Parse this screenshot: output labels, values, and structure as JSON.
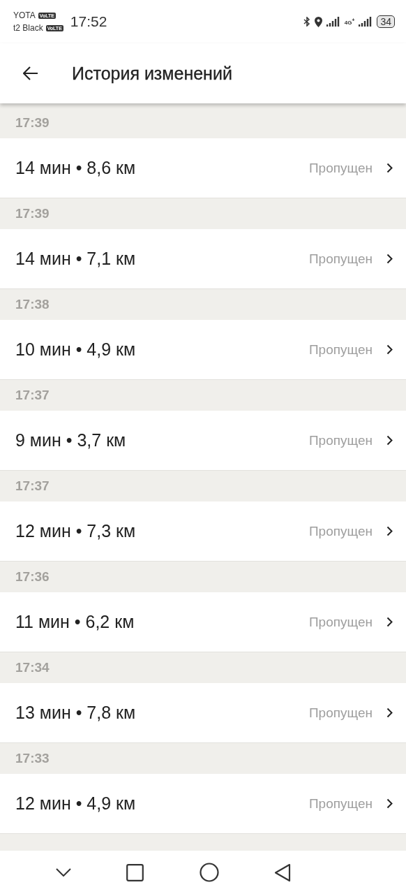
{
  "status_bar": {
    "carriers": [
      {
        "name": "YOTA",
        "badge": "VoLTE"
      },
      {
        "name": "t2 Black",
        "badge": "VoLTE"
      }
    ],
    "time": "17:52",
    "network": "4G$^{+}$",
    "battery": "34"
  },
  "app_bar": {
    "title": "История изменений"
  },
  "history": [
    {
      "time": "17:39",
      "summary": "14 мин • 8,6 км",
      "status": "Пропущен"
    },
    {
      "time": "17:39",
      "summary": "14 мин • 7,1 км",
      "status": "Пропущен"
    },
    {
      "time": "17:38",
      "summary": "10 мин • 4,9 км",
      "status": "Пропущен"
    },
    {
      "time": "17:37",
      "summary": "9 мин • 3,7 км",
      "status": "Пропущен"
    },
    {
      "time": "17:37",
      "summary": "12 мин • 7,3 км",
      "status": "Пропущен"
    },
    {
      "time": "17:36",
      "summary": "11 мин • 6,2 км",
      "status": "Пропущен"
    },
    {
      "time": "17:34",
      "summary": "13 мин • 7,8 км",
      "status": "Пропущен"
    },
    {
      "time": "17:33",
      "summary": "12 мин • 4,9 км",
      "status": "Пропущен"
    }
  ]
}
